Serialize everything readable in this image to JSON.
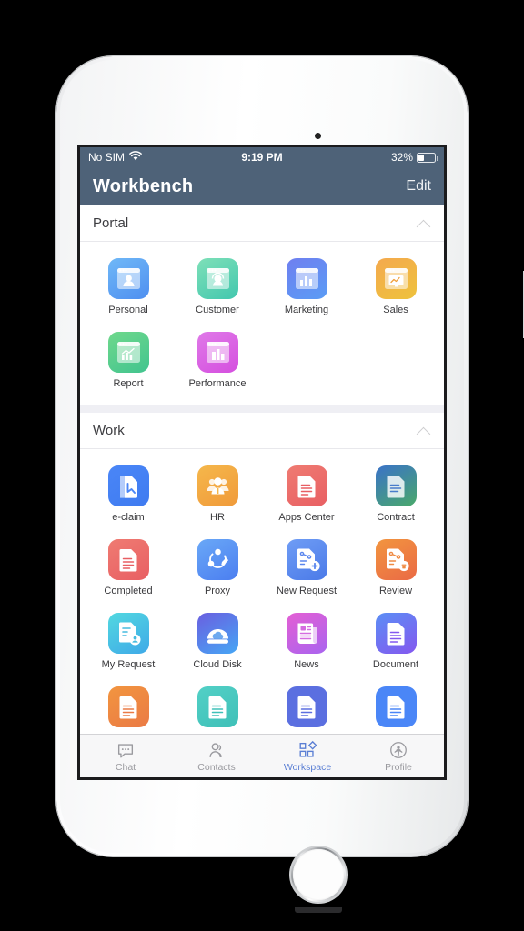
{
  "status_bar": {
    "carrier": "No SIM",
    "wifi_icon": "wifi-icon",
    "time": "9:19 PM",
    "battery_percent": "32%",
    "battery_icon": "battery-icon"
  },
  "nav_bar": {
    "title": "Workbench",
    "edit_label": "Edit"
  },
  "colors": {
    "nav_background": "#4e6278",
    "screen_background": "#efeff4",
    "tab_active": "#5b7fd4",
    "tab_inactive": "#9a9a9f"
  },
  "sections": [
    {
      "title": "Portal",
      "collapse_icon": "chevron-up-icon",
      "apps": [
        {
          "label": "Personal",
          "icon": "personal-portal-icon",
          "c1": "#6fb8f7",
          "c2": "#4f8ff0",
          "glyph": "window-person"
        },
        {
          "label": "Customer",
          "icon": "customer-portal-icon",
          "c1": "#7ee0b8",
          "c2": "#42c7ae",
          "glyph": "window-headset"
        },
        {
          "label": "Marketing",
          "icon": "marketing-portal-icon",
          "c1": "#6f7ff0",
          "c2": "#5a9cf5",
          "glyph": "window-bars"
        },
        {
          "label": "Sales",
          "icon": "sales-portal-icon",
          "c1": "#f4a94e",
          "c2": "#eec23c",
          "glyph": "window-monitor"
        },
        {
          "label": "Report",
          "icon": "report-portal-icon",
          "c1": "#6fd88c",
          "c2": "#42c48f",
          "glyph": "window-growth"
        },
        {
          "label": "Performance",
          "icon": "performance-portal-icon",
          "c1": "#df79e8",
          "c2": "#d54fdf",
          "glyph": "window-building"
        }
      ]
    },
    {
      "title": "Work",
      "collapse_icon": "chevron-up-icon",
      "apps": [
        {
          "label": "e-claim",
          "icon": "e-claim-icon",
          "c1": "#4a86f7",
          "c2": "#3f7bf0",
          "glyph": "claim-page"
        },
        {
          "label": "HR",
          "icon": "hr-icon",
          "c1": "#f5b74b",
          "c2": "#f09a3a",
          "glyph": "people"
        },
        {
          "label": "Apps Center",
          "icon": "apps-center-icon",
          "c1": "#ef7b72",
          "c2": "#e85f63",
          "glyph": "doc-lines"
        },
        {
          "label": "Contract",
          "icon": "contract-icon",
          "c1": "#3a72c8",
          "c2": "#4aa96a",
          "glyph": "doc-contract"
        },
        {
          "label": "Completed",
          "icon": "completed-icon",
          "c1": "#ef7b72",
          "c2": "#e85f63",
          "glyph": "doc-lines"
        },
        {
          "label": "Proxy",
          "icon": "proxy-icon",
          "c1": "#6aa8f7",
          "c2": "#4b7ef0",
          "glyph": "share-pencil"
        },
        {
          "label": "New Request",
          "icon": "new-request-icon",
          "c1": "#6f9df5",
          "c2": "#4b7ae8",
          "glyph": "doc-plus"
        },
        {
          "label": "Review",
          "icon": "review-icon",
          "c1": "#f2953f",
          "c2": "#ea6a45",
          "glyph": "doc-stamp"
        },
        {
          "label": "My Request",
          "icon": "my-request-icon",
          "c1": "#52d8e0",
          "c2": "#3fa9e8",
          "glyph": "doc-person"
        },
        {
          "label": "Cloud Disk",
          "icon": "cloud-disk-icon",
          "c1": "#6a5fe0",
          "c2": "#46a6f5",
          "glyph": "cloud-disk"
        },
        {
          "label": "News",
          "icon": "news-icon",
          "c1": "#e45fd4",
          "c2": "#a964ef",
          "glyph": "newspaper"
        },
        {
          "label": "Document",
          "icon": "document-icon",
          "c1": "#5b8ef5",
          "c2": "#8458ef",
          "glyph": "doc-lines"
        },
        {
          "label": "",
          "icon": "partial-row-icon-1",
          "c1": "#f2953f",
          "c2": "#ea7a45",
          "glyph": "doc-lines"
        },
        {
          "label": "",
          "icon": "partial-row-icon-2",
          "c1": "#52d0c6",
          "c2": "#3fc0b8",
          "glyph": "doc-lines"
        },
        {
          "label": "",
          "icon": "partial-row-icon-3",
          "c1": "#5b6fe0",
          "c2": "#5b6fe0",
          "glyph": "doc-lines"
        },
        {
          "label": "",
          "icon": "partial-row-icon-4",
          "c1": "#4a86f7",
          "c2": "#4a86f7",
          "glyph": "doc-lines"
        }
      ]
    }
  ],
  "tab_bar": {
    "tabs": [
      {
        "label": "Chat",
        "icon": "chat-bubble-icon",
        "active": false
      },
      {
        "label": "Contacts",
        "icon": "contacts-icon",
        "active": false
      },
      {
        "label": "Workspace",
        "icon": "workspace-grid-icon",
        "active": true
      },
      {
        "label": "Profile",
        "icon": "profile-icon",
        "active": false
      }
    ]
  }
}
